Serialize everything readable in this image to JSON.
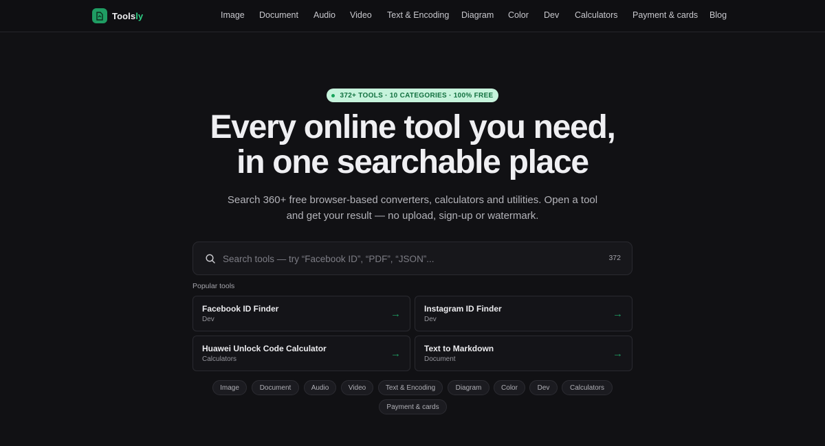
{
  "brand": {
    "name_main": "Tools",
    "name_accent": "ly"
  },
  "nav": [
    "Image",
    "Document",
    "Audio",
    "Video",
    "Text & Encoding",
    "Diagram",
    "Color",
    "Dev",
    "Calculators",
    "Payment & cards",
    "Blog"
  ],
  "hero": {
    "badge": "372+ TOOLS · 10 CATEGORIES · 100% FREE",
    "title_line1": "Every online tool you need,",
    "title_line2": "in one searchable place",
    "subtitle_line1": "Search 360+ free browser-based converters, calculators and utilities. Open a tool",
    "subtitle_line2": "and get your result — no upload, sign-up or watermark."
  },
  "search": {
    "placeholder": "Search tools — try “Facebook ID”, “PDF”, “JSON”...",
    "value": "",
    "count": "372"
  },
  "popular": {
    "label": "Popular tools",
    "tools": [
      {
        "name": "Facebook ID Finder",
        "category": "Dev"
      },
      {
        "name": "Instagram ID Finder",
        "category": "Dev"
      },
      {
        "name": "Huawei Unlock Code Calculator",
        "category": "Calculators"
      },
      {
        "name": "Text to Markdown",
        "category": "Document"
      }
    ]
  },
  "categories": [
    "Image",
    "Document",
    "Audio",
    "Video",
    "Text & Encoding",
    "Diagram",
    "Color",
    "Dev",
    "Calculators",
    "Payment & cards"
  ],
  "colors": {
    "background": "#111114",
    "accent": "#1f9d63",
    "badge_bg": "#c6f3dc"
  },
  "icons": {
    "logo": "document-icon",
    "search": "search-icon",
    "card_arrow": "arrow-right-icon"
  }
}
